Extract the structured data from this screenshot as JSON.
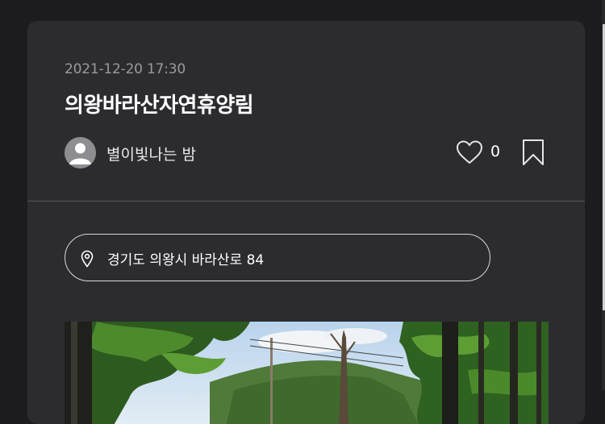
{
  "post": {
    "date": "2021-12-20 17:30",
    "title": "의왕바라산자연휴양림",
    "author": "별이빛나는 밤",
    "like_count": "0",
    "location": "경기도 의왕시 바라산로 84"
  },
  "icons": {
    "avatar": "user-avatar-icon",
    "like": "heart-icon",
    "bookmark": "bookmark-icon",
    "location": "map-pin-icon"
  },
  "colors": {
    "page_background": "#1c1c20",
    "card_background": "#2c2c30",
    "divider": "#55555a",
    "date_text": "#9a9a9f"
  }
}
